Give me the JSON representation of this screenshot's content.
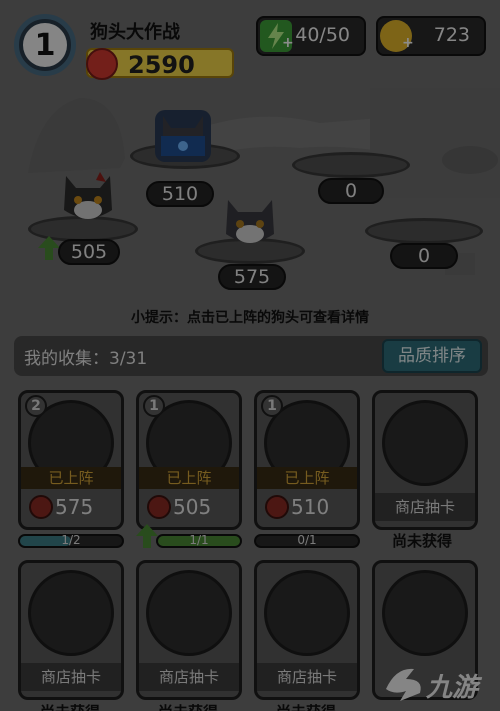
{
  "header": {
    "level": "1",
    "game_name": "狗头大作战",
    "score": "2590",
    "energy": "40/50",
    "coins": "723"
  },
  "field": {
    "slots": [
      {
        "value": "510",
        "occupied": true,
        "dog": "blue-mask-husky"
      },
      {
        "value": "0",
        "occupied": false
      },
      {
        "value": "505",
        "occupied": true,
        "dog": "black-husky",
        "upgrade_arrow": true
      },
      {
        "value": "575",
        "occupied": true,
        "dog": "gray-husky"
      },
      {
        "value": "0",
        "occupied": false
      }
    ]
  },
  "hint": "小提示：点击已上阵的狗头可查看详情",
  "collection": {
    "label": "我的收集：3/31",
    "sort_button": "品质排序",
    "cards": [
      {
        "badge": "2",
        "status": "已上阵",
        "power": "575",
        "progress": "1/2",
        "progress_value": 0.5,
        "fill": "#3c7f88"
      },
      {
        "badge": "1",
        "status": "已上阵",
        "power": "505",
        "progress": "1/1",
        "progress_value": 1.0,
        "fill": "#4c8a35",
        "arrow": true
      },
      {
        "badge": "1",
        "status": "已上阵",
        "power": "510",
        "progress": "0/1",
        "progress_value": 0.0,
        "fill": "#3c7f88"
      },
      {
        "status_shop": "商店抽卡",
        "unobtained": "尚未获得"
      },
      {
        "status_shop": "商店抽卡",
        "unobtained": "尚未获得"
      },
      {
        "status_shop": "商店抽卡",
        "unobtained": "尚未获得"
      },
      {
        "status_shop": "商店抽卡",
        "unobtained": "尚未获得"
      }
    ]
  },
  "watermark": "九游",
  "colors": {
    "gold": "#f4d84a",
    "red_icon": "#d23a30",
    "energy": "#3fa03a",
    "teal": "#2f6d7a"
  }
}
